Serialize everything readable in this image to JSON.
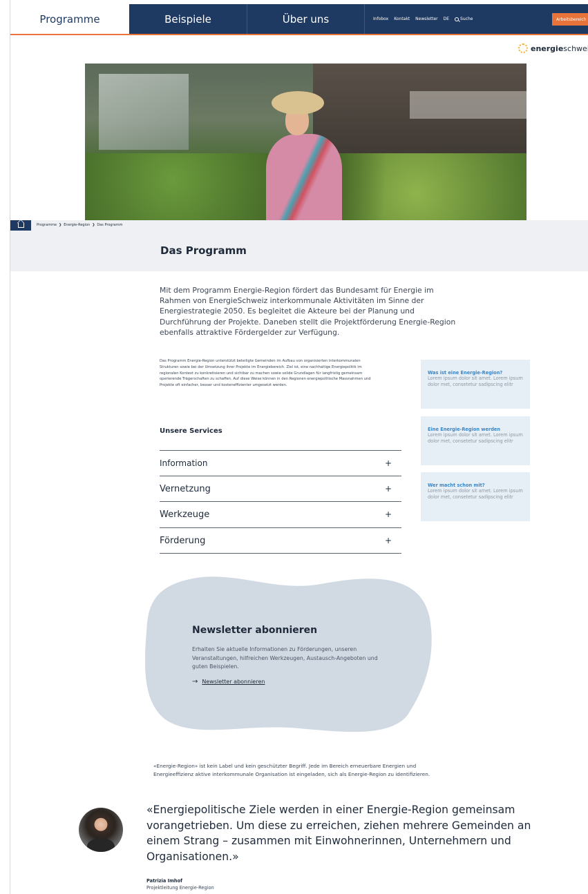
{
  "nav": {
    "tabs": [
      {
        "label": "Programme",
        "active": true
      },
      {
        "label": "Beispiele",
        "active": false
      },
      {
        "label": "Über uns",
        "active": false
      }
    ],
    "utility": [
      "Infobox",
      "Kontakt",
      "Newsletter",
      "DE"
    ],
    "search_label": "Suche",
    "work_button": "Arbeitsbereich"
  },
  "logo": {
    "bold": "energie",
    "thin": "schwei"
  },
  "breadcrumb": [
    "Programme",
    "Energie-Region",
    "Das Programm"
  ],
  "page_title": "Das Programm",
  "intro": "Mit dem Programm Energie-Region fördert das Bundesamt für Energie im Rahmen von EnergieSchweiz interkommunale Aktivitäten im Sinne der Energiestrategie 2050. Es begleitet die Akteure bei der Planung und Durchführung der Projekte. Daneben stellt die Projektförderung Energie-Region ebenfalls attraktive Fördergelder zur Verfügung.",
  "body_text": "Das Programm Energie-Region unterstützt beteiligte Gemeinden im Aufbau von organisierten interkommunalen Strukturen sowie bei der Umsetzung ihrer Projekte im Energiebereich. Ziel ist, eine nachhaltige Energiepolitik im regionalen Kontext zu konkretisieren und sichtbar zu machen sowie solide Grundlagen für langfristig gemeinsam operierende Trägerschaften zu schaffen. Auf diese Weise können in den Regionen energiepolitische Massnahmen und Projekte oft einfacher, besser und kosteneffizienter umgesetzt werden.",
  "cards": [
    {
      "title": "Was ist eine Energie-Region?",
      "text": "Lorem ipsum dolor sit amet. Lorem ipsum dolor met, consetetur sadipscing elitr"
    },
    {
      "title": "Eine Energie-Region werden",
      "text": "Lorem ipsum dolor sit amet. Lorem ipsum dolor met, consetetur sadipscing elitr"
    },
    {
      "title": "Wer macht schon mit?",
      "text": "Lorem ipsum dolor sit amet. Lorem ipsum dolor met, consetetur sadipscing elitr"
    }
  ],
  "services": {
    "title": "Unsere Services",
    "items": [
      "Information",
      "Vernetzung",
      "Werkzeuge",
      "Förderung"
    ],
    "expand_symbol": "+"
  },
  "newsletter": {
    "title": "Newsletter abonnieren",
    "text": "Erhalten Sie aktuelle Informationen zu Förderungen, unseren Veranstaltungen, hilfreichen Werkzeugen, Austausch-Angeboten und guten Beispielen.",
    "link": "Newsletter abonnieren",
    "arrow": "→"
  },
  "foot_text": "«Energie-Region» ist kein Label und kein geschützter Begriff. Jede im Bereich erneuerbare Energien und Energieeffizienz aktive interkommunale Organisation ist eingeladen, sich als Energie-Region zu identifizieren.",
  "quote": {
    "text": "«Energiepolitische Ziele werden in einer Energie-Region gemeinsam vorangetrieben. Um diese zu erreichen, ziehen mehrere Gemeinden an einem Strang – zusammen mit Einwohnerinnen, Unternehmern und Organisationen.»",
    "author": "Patrizia Imhof",
    "role": "Projektleitung Energie-Region"
  },
  "colors": {
    "navy": "#1e3a63",
    "accent": "#e8743b",
    "card_bg": "#e6eef6",
    "card_title": "#3a86c8",
    "blob": "#d1d9e2"
  }
}
